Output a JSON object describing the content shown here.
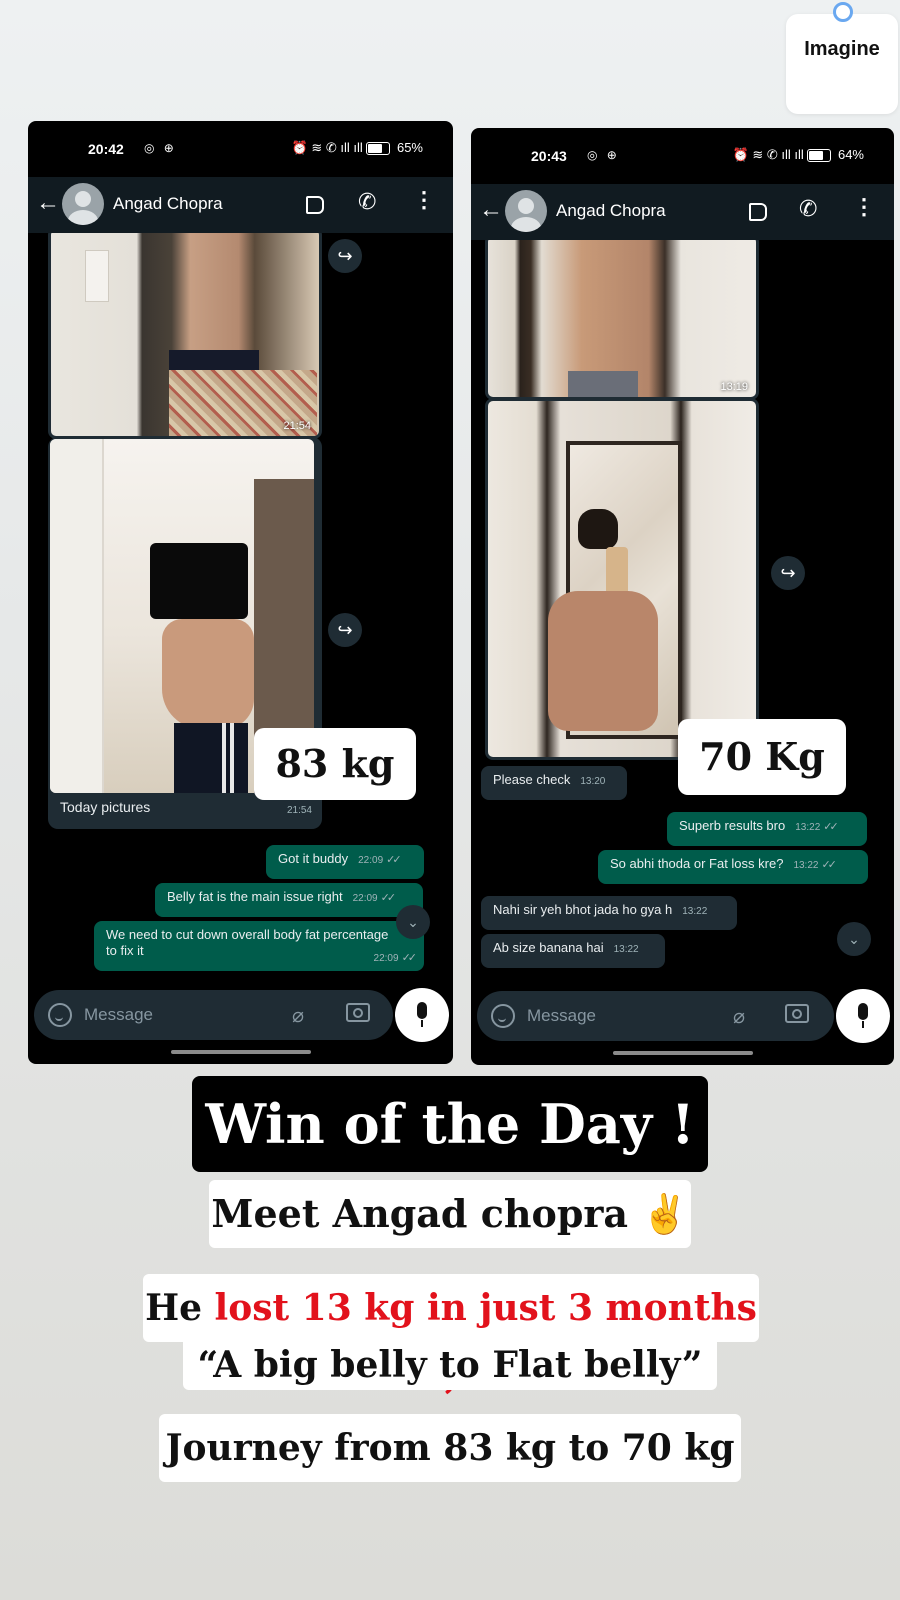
{
  "imagine_badge": {
    "label": "Imagine"
  },
  "left_phone": {
    "status_time": "20:42",
    "status_battery": "65%",
    "contact_name": "Angad Chopra",
    "photo1_time": "21:54",
    "photo2_time": "21:54",
    "photo_caption": "Today pictures",
    "weight_label": "83 kg",
    "messages": [
      {
        "text": "Got it buddy",
        "time": "22:09",
        "dir": "out"
      },
      {
        "text": "Belly fat is the main issue right",
        "time": "22:09",
        "dir": "out"
      },
      {
        "text": "We need to cut down overall body fat percentage to fix it",
        "line1": "We need to cut down overall body fat percentage",
        "line2": "to fix it",
        "time": "22:09",
        "dir": "out"
      }
    ],
    "input_placeholder": "Message"
  },
  "right_phone": {
    "status_time": "20:43",
    "status_battery": "64%",
    "contact_name": "Angad Chopra",
    "photo1_time": "13:19",
    "weight_label": "70 Kg",
    "messages": [
      {
        "text": "Please check",
        "time": "13:20",
        "dir": "in"
      },
      {
        "text": "Superb results bro",
        "time": "13:22",
        "dir": "out"
      },
      {
        "text": "So abhi thoda or Fat loss kre?",
        "time": "13:22",
        "dir": "out"
      },
      {
        "text": "Nahi sir yeh bhot jada ho gya h",
        "time": "13:22",
        "dir": "in"
      },
      {
        "text": "Ab size banana hai",
        "time": "13:22",
        "dir": "in"
      }
    ],
    "input_placeholder": "Message"
  },
  "headline": "Win of the Day !",
  "meet_line": "Meet Angad chopra ✌️",
  "lost_prefix": "He ",
  "lost_highlight": "lost 13 kg in just 3 months ,",
  "belly_quote": "“A big belly to Flat belly”",
  "journey_line": "Journey from 83 kg to 70 kg"
}
